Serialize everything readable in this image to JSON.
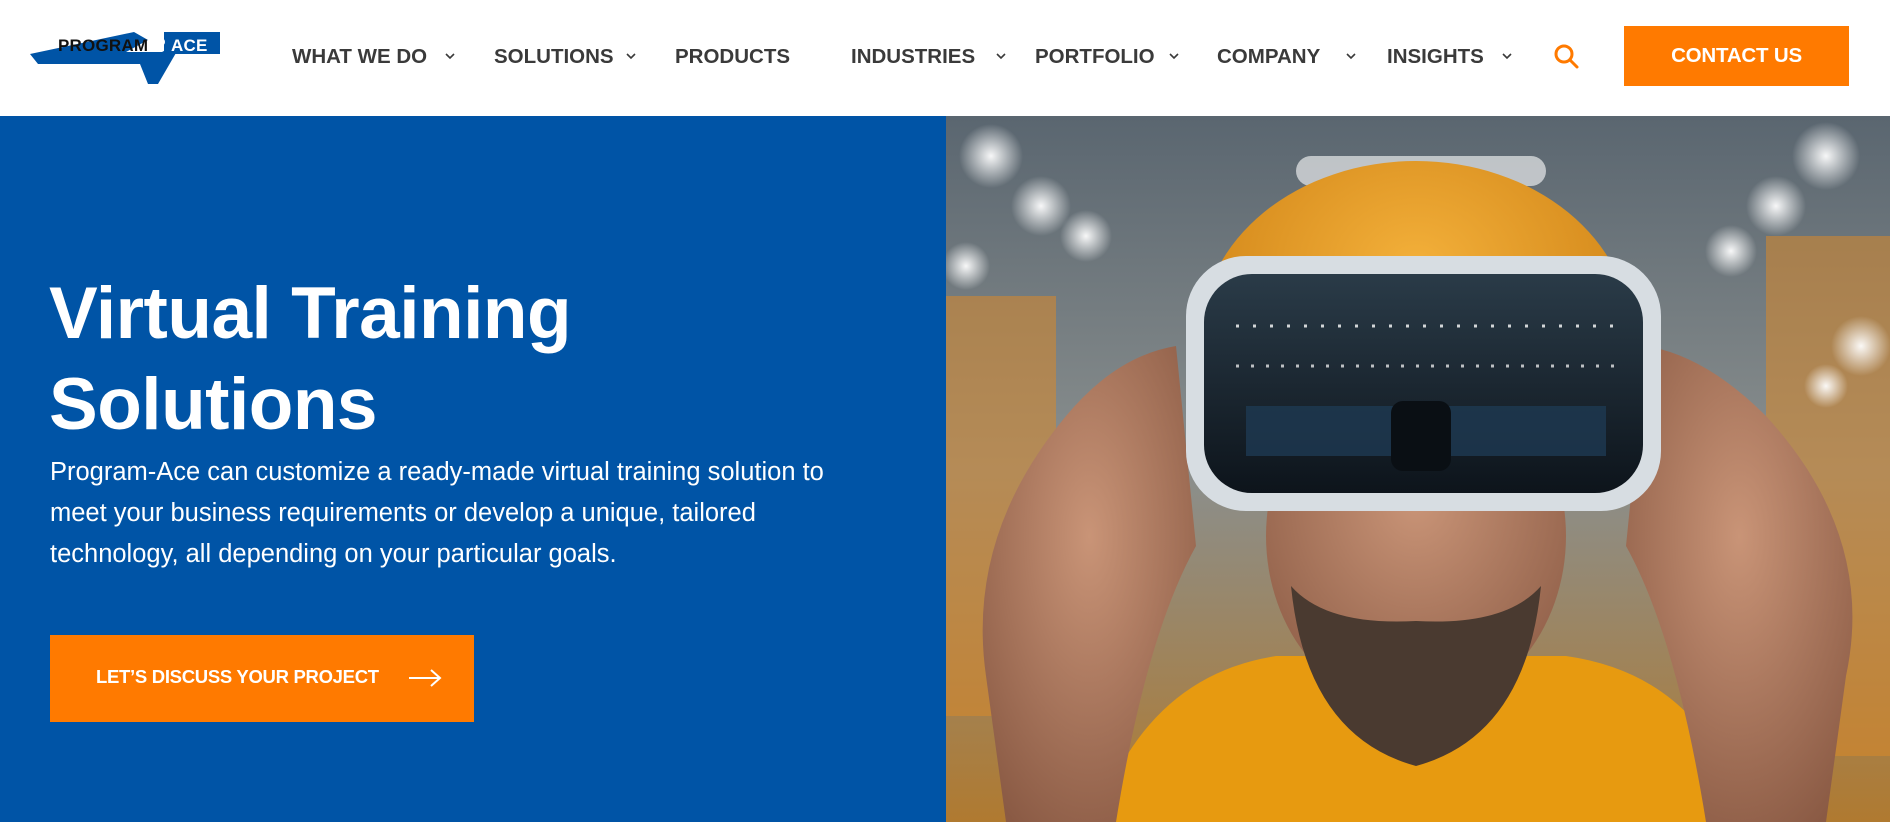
{
  "header": {
    "logo": {
      "text_left": "PROGRAM",
      "text_right": "ACE"
    },
    "nav": [
      {
        "label": "WHAT WE DO",
        "has_dropdown": true
      },
      {
        "label": "SOLUTIONS",
        "has_dropdown": true
      },
      {
        "label": "PRODUCTS",
        "has_dropdown": false
      },
      {
        "label": "INDUSTRIES",
        "has_dropdown": true
      },
      {
        "label": "PORTFOLIO",
        "has_dropdown": true
      },
      {
        "label": "COMPANY",
        "has_dropdown": true
      },
      {
        "label": "INSIGHTS",
        "has_dropdown": true
      }
    ],
    "search_icon": "search-icon",
    "contact_label": "CONTACT US"
  },
  "hero": {
    "title_line1": "Virtual Training",
    "title_line2": "Solutions",
    "description": "Program-Ace can customize a ready-made virtual training solution to meet your business requirements or develop a unique, tailored technology, all depending on your particular goals.",
    "cta_label": "LET’S DISCUSS YOUR PROJECT",
    "cta_icon": "arrow-right-icon",
    "image_subject": "man-wearing-vr-headset-and-hard-hat"
  },
  "colors": {
    "brand_blue": "#0054a6",
    "accent_orange": "#ff7a00",
    "nav_text": "#3a3a3a",
    "white": "#ffffff"
  }
}
